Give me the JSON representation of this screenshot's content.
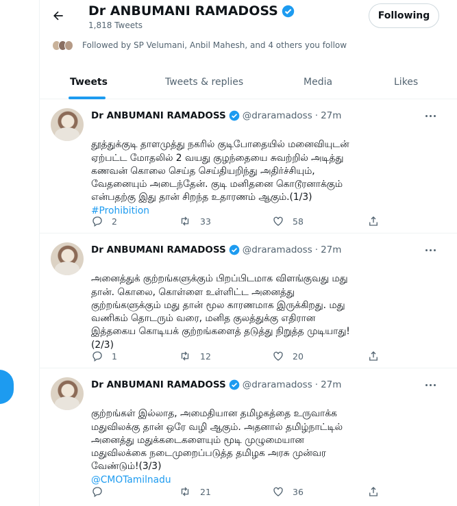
{
  "header": {
    "name": "Dr ANBUMANI RAMADOSS",
    "tweet_count": "1,818 Tweets",
    "follow_label": "Following",
    "followed_by": "Followed by SP Velumani, Anbil Mahesh, and 4 others you follow"
  },
  "tabs": [
    {
      "label": "Tweets",
      "active": true
    },
    {
      "label": "Tweets & replies",
      "active": false
    },
    {
      "label": "Media",
      "active": false
    },
    {
      "label": "Likes",
      "active": false
    }
  ],
  "tweets": [
    {
      "name": "Dr ANBUMANI RAMADOSS",
      "handle": "@draramadoss",
      "dot": "·",
      "time": "27m",
      "text": "தூத்துக்குடி தாளமுத்து நகரில் குடிபோதையில் மனைவியுடன்\nஏற்பட்ட மோதலில் 2 வயது குழந்தையை சுவற்றில் அடித்து\nகணவன் கொலை செய்த செய்தியறிந்து அதிர்ச்சியும்,\nவேதனையும் அடைந்தேன். குடி மனிதனை கொடூரனாக்கும்\nஎன்பதற்கு இது தான் சிறந்த உதாரணம் ஆகும்.(1/3)",
      "link": "#Prohibition",
      "replies": "2",
      "retweets": "33",
      "likes": "58"
    },
    {
      "name": "Dr ANBUMANI RAMADOSS",
      "handle": "@draramadoss",
      "dot": "·",
      "time": "27m",
      "text": "அனைத்துக் குற்றங்களுக்கும் பிறப்பிடமாக விளங்குவது மது\nதான். கொலை, கொள்ளை உள்ளிட்ட அனைத்து\nகுற்றங்களுக்கும் மது தான் மூல காரணமாக இருக்கிறது. மது\nவணிகம் தொடரும் வரை, மனித குலத்துக்கு எதிரான\nஇத்தகைய கொடியக் குற்றங்களைத் தடுத்து நிறுத்த முடியாது!\n(2/3)",
      "link": "",
      "replies": "1",
      "retweets": "12",
      "likes": "20"
    },
    {
      "name": "Dr ANBUMANI RAMADOSS",
      "handle": "@draramadoss",
      "dot": "·",
      "time": "27m",
      "text": "குற்றங்கள் இல்லாத, அமைதியான தமிழகத்தை உருவாக்க\nமதுவிலக்கு தான் ஒரே வழி ஆகும். அதனால் தமிழ்நாட்டில்\nஅனைத்து மதுக்கடைகளையும் மூடி முழுமையான\nமதுவிலக்கை நடைமுறைப்படுத்த தமிழக அரசு முன்வர\nவேண்டும்!(3/3)",
      "link": "@CMOTamilnadu",
      "replies": "",
      "retweets": "21",
      "likes": "36"
    }
  ],
  "colors": {
    "accent": "#1d9bf0",
    "verified": "#1d9bf0",
    "text": "#0f1419",
    "muted": "#536471",
    "divider": "#eff3f4"
  },
  "icons": [
    "back-arrow-icon",
    "verified-badge-icon",
    "more-icon",
    "reply-icon",
    "retweet-icon",
    "like-icon",
    "share-icon"
  ]
}
